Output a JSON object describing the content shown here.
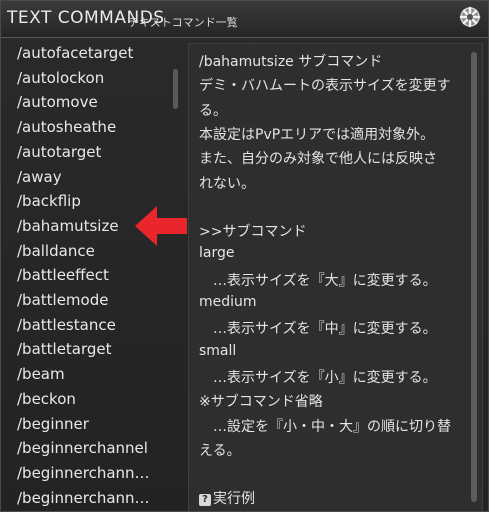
{
  "window": {
    "title": "TEXT COMMANDS",
    "subtitle": "テキストコマンド一覧",
    "settings_icon": "gear-icon"
  },
  "command_list": {
    "selected": "/bahamutsize",
    "items": [
      "/autofacetarget",
      "/autolockon",
      "/automove",
      "/autosheathe",
      "/autotarget",
      "/away",
      "/backflip",
      "/bahamutsize",
      "/balldance",
      "/battleeffect",
      "/battlemode",
      "/battlestance",
      "/battletarget",
      "/beam",
      "/beckon",
      "/beginner",
      "/beginnerchannel",
      "/beginnerchann…",
      "/beginnerchann…"
    ]
  },
  "detail": {
    "lines": [
      "/bahamutsize サブコマンド",
      "デミ・バハムートの表示サイズを変更す",
      "る。",
      "本設定はPvPエリアでは適用対象外。",
      "また、自分のみ対象で他人には反映さ",
      "れない。",
      "",
      ">>サブコマンド",
      "large",
      "　…表示サイズを『大』に変更する。",
      "medium",
      "　…表示サイズを『中』に変更する。",
      "small",
      "　…表示サイズを『小』に変更する。",
      "※サブコマンド省略",
      "　…設定を『小・中・大』の順に切り替",
      "える。",
      "",
      "実行例"
    ]
  },
  "annotation": {
    "arrow_color": "#e8262b"
  }
}
